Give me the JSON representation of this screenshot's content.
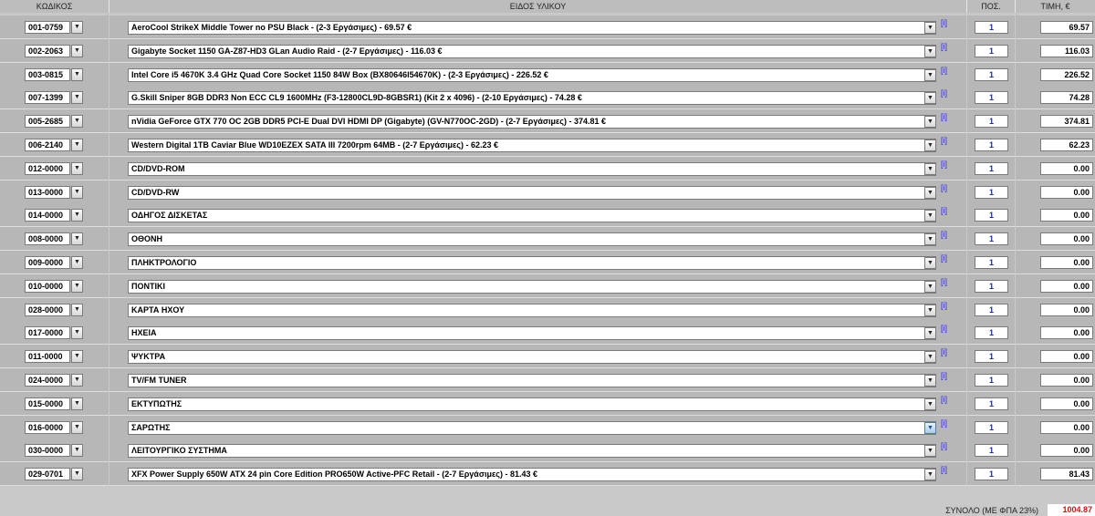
{
  "header": {
    "code": "ΚΩΔΙΚΟΣ",
    "item": "ΕΙΔΟΣ ΥΛΙΚΟΥ",
    "qty": "ΠΟΣ.",
    "price": "ΤΙΜΗ, €"
  },
  "icons": {
    "dropdown": "chevron-down-icon",
    "info": "info-link"
  },
  "info_label": "[i]",
  "rows": [
    {
      "code": "001-0759",
      "desc": "AeroCool StrikeX Middle Tower no PSU Black - (2-3 Εργάσιμες) - 69.57 €",
      "qty": "1",
      "price": "69.57"
    },
    {
      "code": "002-2063",
      "desc": "Gigabyte Socket 1150 GA-Z87-HD3 GLan Audio Raid - (2-7 Εργάσιμες) - 116.03 €",
      "qty": "1",
      "price": "116.03"
    },
    {
      "code": "003-0815",
      "desc": "Intel Core i5 4670K 3.4 GHz Quad Core Socket 1150 84W Box (BX80646I54670K) - (2-3 Εργάσιμες) - 226.52 €",
      "qty": "1",
      "price": "226.52"
    },
    {
      "code": "007-1399",
      "desc": "G.Skill Sniper 8GB DDR3 Non ECC CL9 1600MHz (F3-12800CL9D-8GBSR1) (Kit 2 x 4096) - (2-10 Εργάσιμες) - 74.28 €",
      "qty": "1",
      "price": "74.28"
    },
    {
      "code": "005-2685",
      "desc": "nVidia GeForce GTX 770 OC 2GB DDR5 PCI-E Dual DVI HDMI DP (Gigabyte) (GV-N770OC-2GD) - (2-7 Εργάσιμες) - 374.81 €",
      "qty": "1",
      "price": "374.81"
    },
    {
      "code": "006-2140",
      "desc": "Western Digital 1TB Caviar Blue WD10EZEX SATA III 7200rpm 64MB - (2-7 Εργάσιμες) - 62.23 €",
      "qty": "1",
      "price": "62.23"
    },
    {
      "code": "012-0000",
      "desc": "CD/DVD-ROM",
      "qty": "1",
      "price": "0.00"
    },
    {
      "code": "013-0000",
      "desc": "CD/DVD-RW",
      "qty": "1",
      "price": "0.00"
    },
    {
      "code": "014-0000",
      "desc": "ΟΔΗΓΟΣ ΔΙΣΚΕΤΑΣ",
      "qty": "1",
      "price": "0.00"
    },
    {
      "code": "008-0000",
      "desc": "ΟΘΟΝΗ",
      "qty": "1",
      "price": "0.00"
    },
    {
      "code": "009-0000",
      "desc": "ΠΛΗΚΤΡΟΛΟΓΙΟ",
      "qty": "1",
      "price": "0.00"
    },
    {
      "code": "010-0000",
      "desc": "ΠΟΝΤΙΚΙ",
      "qty": "1",
      "price": "0.00"
    },
    {
      "code": "028-0000",
      "desc": "ΚΑΡΤΑ ΗΧΟΥ",
      "qty": "1",
      "price": "0.00"
    },
    {
      "code": "017-0000",
      "desc": "ΗΧΕΙΑ",
      "qty": "1",
      "price": "0.00"
    },
    {
      "code": "011-0000",
      "desc": "ΨΥΚΤΡΑ",
      "qty": "1",
      "price": "0.00"
    },
    {
      "code": "024-0000",
      "desc": "TV/FM TUNER",
      "qty": "1",
      "price": "0.00"
    },
    {
      "code": "015-0000",
      "desc": "ΕΚΤΥΠΩΤΗΣ",
      "qty": "1",
      "price": "0.00"
    },
    {
      "code": "016-0000",
      "desc": "ΣΑΡΩΤΗΣ",
      "qty": "1",
      "price": "0.00"
    },
    {
      "code": "030-0000",
      "desc": "ΛΕΙΤΟΥΡΓΙΚΟ ΣΥΣΤΗΜΑ",
      "qty": "1",
      "price": "0.00"
    },
    {
      "code": "029-0701",
      "desc": "XFX Power Supply 650W ATX 24 pin Core Edition PRO650W Active-PFC Retail - (2-7 Εργάσιμες) - 81.43 €",
      "qty": "1",
      "price": "81.43"
    }
  ],
  "footer": {
    "total_label": "ΣΥΝΟΛΟ (ΜΕ ΦΠΑ 23%)",
    "total_value": "1004.87"
  },
  "colors": {
    "total": "#d01010",
    "info_link": "#2b2bd6",
    "qty_text": "#1b2f9a"
  }
}
